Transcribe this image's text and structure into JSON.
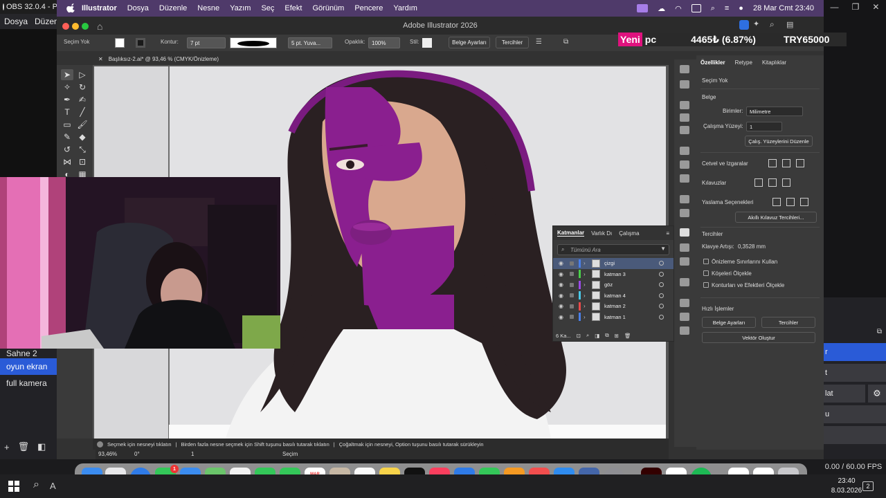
{
  "obs": {
    "title": "OBS 32.0.4 - Pr",
    "menu": [
      "Dosya",
      "Düzen"
    ],
    "scenes": [
      "Sahne 2",
      "oyun ekran",
      "full kamera"
    ],
    "active_scene": "oyun ekran",
    "fps": "0.00 / 60.00 FPS",
    "right_buttons": [
      "r",
      "t",
      "lat",
      "u"
    ]
  },
  "ticker": {
    "highlight": "Yeni",
    "label": "pc",
    "value": "4465₺ (6.87%)",
    "currency": "TRY65000"
  },
  "mac": {
    "app": "Illustrator",
    "menu": [
      "Dosya",
      "Düzenle",
      "Nesne",
      "Yazım",
      "Seç",
      "Efekt",
      "Görünüm",
      "Pencere",
      "Yardım"
    ],
    "datetime": "28 Mar Cmt  23:40"
  },
  "ai": {
    "window_title": "Adobe Illustrator 2026",
    "control": {
      "selection": "Seçim Yok",
      "stroke_label": "Kontur:",
      "stroke_value": "7 pt",
      "brush": "5 pt. Yuva...",
      "opacity_label": "Opaklık:",
      "opacity_value": "100%",
      "style_label": "Stil:",
      "doc_setup": "Belge Ayarları",
      "prefs": "Tercihler"
    },
    "doc_tab": "Başlıksız-2.ai* @ 93,46 % (CMYK/Önizleme)",
    "status": [
      "Seçmek için nesneyi tıklatın",
      "Birden fazla nesne seçmek için Shift tuşunu basılı tutarak tıklatın",
      "Çoğaltmak için nesneyi, Option tuşunu basılı tutarak sürükleyin"
    ],
    "zoom": "93,46%",
    "rotation": "0°",
    "artboard_num": "1",
    "tool_mode": "Seçim"
  },
  "properties": {
    "tabs": [
      "Özellikler",
      "Retype",
      "Kitaplıklar"
    ],
    "no_selection": "Seçim Yok",
    "document": "Belge",
    "units_label": "Birimler:",
    "units_value": "Milimetre",
    "artboard_label": "Çalışma Yüzeyi:",
    "artboard_value": "1",
    "edit_artboards": "Çalış. Yüzeylerini Düzenle",
    "rulers": "Cetvel ve Izgaralar",
    "guides": "Kılavuzlar",
    "snap": "Yaslama Seçenekleri",
    "smart_guides": "Akıllı Kılavuz Tercihleri...",
    "prefs_title": "Tercihler",
    "key_inc_label": "Klavye Artışı:",
    "key_inc_value": "0,3528 mm",
    "checks": [
      "Önizleme Sınırlarını Kullan",
      "Köşeleri Ölçekle",
      "Konturları ve Efektleri Ölçekle"
    ],
    "quick_title": "Hızlı İşlemler",
    "doc_setup": "Belge Ayarları",
    "prefs_btn": "Tercihler",
    "vector": "Vektör Oluştur"
  },
  "layers": {
    "tabs": [
      "Katmanlar",
      "Varlık Dı",
      "Çalışma"
    ],
    "search": "Tümünü Ara",
    "rows": [
      {
        "name": "çizgi",
        "color": "#4a7fe8"
      },
      {
        "name": "katman 3",
        "color": "#4ad04a"
      },
      {
        "name": "göz",
        "color": "#9a4ae8"
      },
      {
        "name": "katman 4",
        "color": "#4ac8e8"
      },
      {
        "name": "katman 2",
        "color": "#e84a4a"
      },
      {
        "name": "katman 1",
        "color": "#4a7fe8"
      }
    ],
    "footer": "6 Ka..."
  },
  "windows": {
    "time": "23:40",
    "date": "8.03.2026",
    "notifications": "2",
    "search_letter": "A"
  },
  "dock": {
    "calendar_day": "28",
    "calendar_month": "MAR",
    "mail_badge": "1"
  }
}
